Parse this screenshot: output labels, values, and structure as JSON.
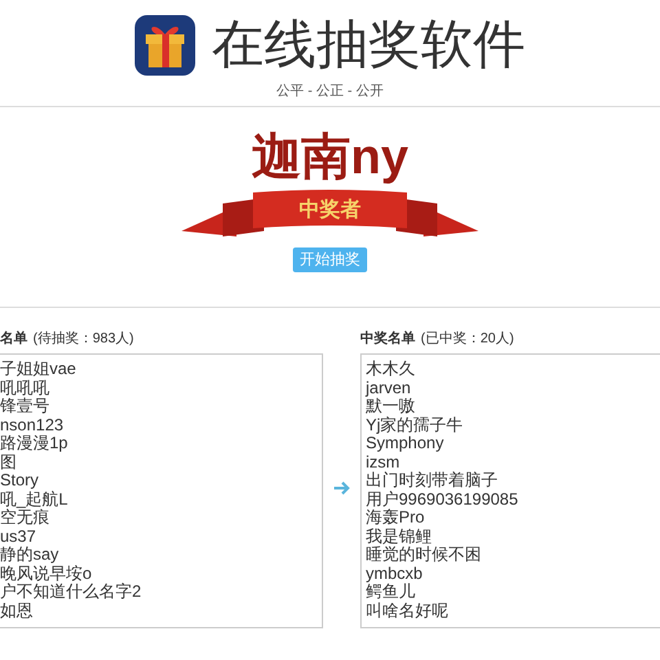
{
  "header": {
    "title": "在线抽奖软件",
    "subtitle": "公平 - 公正 - 公开"
  },
  "winner": {
    "name": "迦南ny",
    "ribbon_text": "中奖者",
    "button": "开始抽奖"
  },
  "pending": {
    "heading": "名单",
    "count": "(待抽奖：983人)",
    "names": [
      "子姐姐vae",
      "吼吼吼",
      "锋壹号",
      "nson123",
      "路漫漫1p",
      "图",
      "Story",
      "吼_起航L",
      "空无痕",
      "us37",
      "静的say",
      "晚风说早垵o",
      "户不知道什么名字2",
      "如恩"
    ]
  },
  "winners": {
    "heading": "中奖名单",
    "count": "(已中奖：20人)",
    "names": [
      "木木久",
      "jarven",
      "默一嗷",
      "Yj家的孺子牛",
      "Symphony",
      "izsm",
      "出门时刻带着脑子",
      "用户9969036199085",
      "海轰Pro",
      "我是锦鲤",
      "睡觉的时候不困",
      "ymbcxb",
      "鳄鱼儿",
      "叫啥名好呢"
    ]
  }
}
